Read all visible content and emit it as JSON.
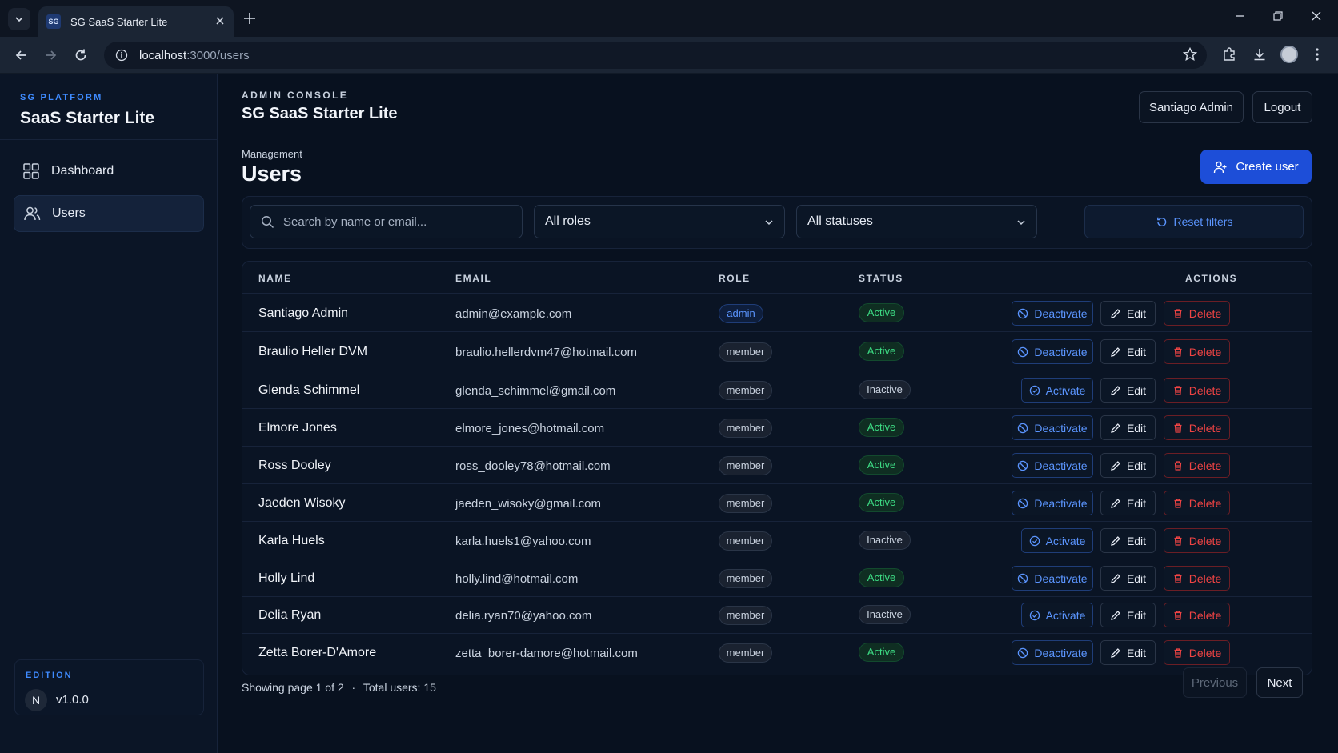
{
  "browser": {
    "tab_title": "SG SaaS Starter Lite",
    "favicon_text": "SG",
    "url_host": "localhost",
    "url_path": ":3000/users"
  },
  "sidebar": {
    "kicker": "SG PLATFORM",
    "title": "SaaS Starter Lite",
    "items": [
      {
        "label": "Dashboard",
        "icon": "grid-icon",
        "active": false
      },
      {
        "label": "Users",
        "icon": "users-icon",
        "active": true
      }
    ],
    "edition": {
      "kicker": "EDITION",
      "badge": "N",
      "version": "v1.0.0"
    }
  },
  "header": {
    "kicker": "ADMIN CONSOLE",
    "title": "SG SaaS Starter Lite",
    "user_label": "Santiago Admin",
    "logout_label": "Logout"
  },
  "page": {
    "kicker": "Management",
    "title": "Users",
    "create_label": "Create user"
  },
  "filters": {
    "search_placeholder": "Search by name or email...",
    "role_value": "All roles",
    "status_value": "All statuses",
    "reset_label": "Reset filters"
  },
  "table": {
    "columns": [
      "NAME",
      "EMAIL",
      "ROLE",
      "STATUS",
      "ACTIONS"
    ],
    "edit_label": "Edit",
    "delete_label": "Delete",
    "deactivate_label": "Deactivate",
    "activate_label": "Activate",
    "rows": [
      {
        "name": "Santiago Admin",
        "email": "admin@example.com",
        "role": "admin",
        "status": "Active"
      },
      {
        "name": "Braulio Heller DVM",
        "email": "braulio.hellerdvm47@hotmail.com",
        "role": "member",
        "status": "Active"
      },
      {
        "name": "Glenda Schimmel",
        "email": "glenda_schimmel@gmail.com",
        "role": "member",
        "status": "Inactive"
      },
      {
        "name": "Elmore Jones",
        "email": "elmore_jones@hotmail.com",
        "role": "member",
        "status": "Active"
      },
      {
        "name": "Ross Dooley",
        "email": "ross_dooley78@hotmail.com",
        "role": "member",
        "status": "Active"
      },
      {
        "name": "Jaeden Wisoky",
        "email": "jaeden_wisoky@gmail.com",
        "role": "member",
        "status": "Active"
      },
      {
        "name": "Karla Huels",
        "email": "karla.huels1@yahoo.com",
        "role": "member",
        "status": "Inactive"
      },
      {
        "name": "Holly Lind",
        "email": "holly.lind@hotmail.com",
        "role": "member",
        "status": "Active"
      },
      {
        "name": "Delia Ryan",
        "email": "delia.ryan70@yahoo.com",
        "role": "member",
        "status": "Inactive"
      },
      {
        "name": "Zetta Borer-D'Amore",
        "email": "zetta_borer-damore@hotmail.com",
        "role": "member",
        "status": "Active"
      }
    ]
  },
  "pagination": {
    "info": "Showing page 1 of 2",
    "separator": "·",
    "total": "Total users: 15",
    "prev_label": "Previous",
    "next_label": "Next"
  },
  "colors": {
    "accent": "#1d4ed8",
    "link_blue": "#5b95ff",
    "active_green": "#3ddc84",
    "danger_red": "#f04444",
    "background": "#08111f"
  }
}
